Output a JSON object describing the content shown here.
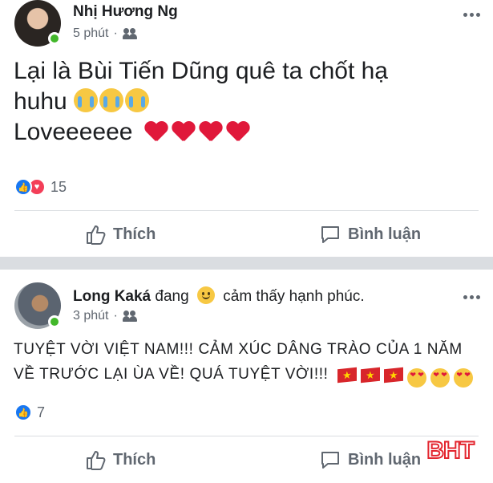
{
  "posts": [
    {
      "author": "Nhị Hương Ng",
      "time": "5 phút",
      "privacy_icon": "friends-icon",
      "text_lines": [
        "Lại là Bùi Tiến Dũng quê ta chốt hạ",
        "huhu",
        "Loveeeeee"
      ],
      "emojis_line2": [
        "crying-face",
        "crying-face",
        "crying-face"
      ],
      "emojis_line3": [
        "heart",
        "heart",
        "heart",
        "heart"
      ],
      "reaction_count": "15",
      "reactions": [
        "like",
        "love"
      ]
    },
    {
      "author": "Long Kaká",
      "feeling_prefix": "đang",
      "feeling_text": "cảm thấy hạnh phúc.",
      "time": "3 phút",
      "privacy_icon": "friends-icon",
      "text_line1": "TUYỆT VỜI VIỆT NAM!!! CẢM XÚC DÂNG TRÀO CỦA 1 NĂM",
      "text_line2": "VỀ TRƯỚC LẠI ÙA VỀ! QUÁ TUYỆT VỜI!!!",
      "emojis": [
        "vietnam-flag",
        "vietnam-flag",
        "vietnam-flag",
        "heart-eyes",
        "heart-eyes",
        "heart-eyes"
      ],
      "reaction_count": "7",
      "reactions": [
        "like"
      ]
    }
  ],
  "actions": {
    "like_label": "Thích",
    "comment_label": "Bình luận"
  },
  "watermark": "BHT",
  "colors": {
    "accent": "#1877f2",
    "love": "#f33e58",
    "online": "#42b72a",
    "muted": "#606770"
  }
}
